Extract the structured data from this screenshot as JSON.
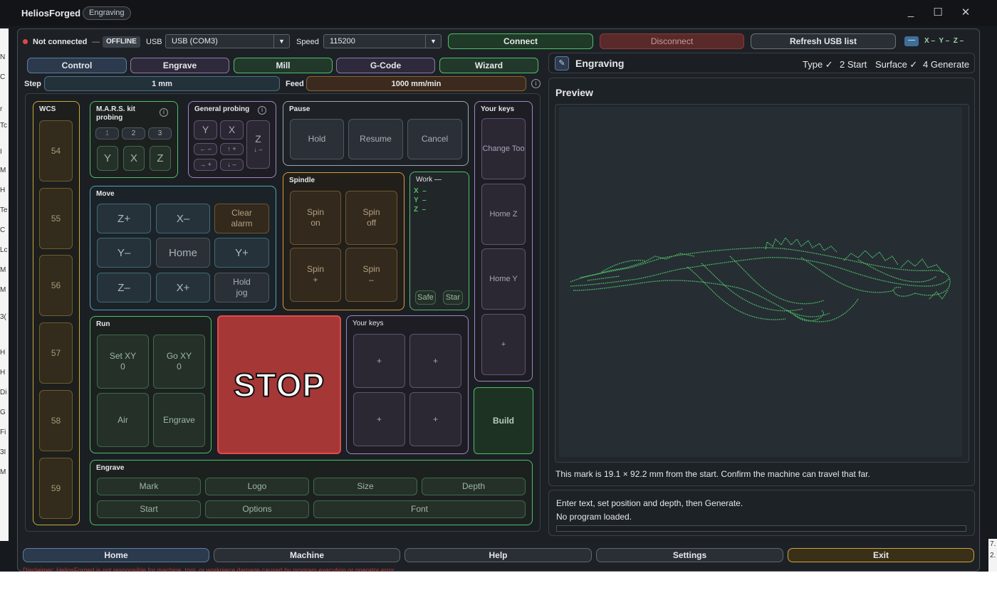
{
  "window": {
    "title": "HeliosForged",
    "badge": "Engraving",
    "controls": {
      "minimize": "_",
      "maximize": "☐",
      "close": "✕"
    }
  },
  "connection": {
    "status": "Not connected",
    "dash": "—",
    "badge": "OFFLINE",
    "usb_label": "USB",
    "usb_value": "USB (COM3)",
    "speed_label": "Speed",
    "speed_value": "115200",
    "connect": "Connect",
    "disconnect": "Disconnect",
    "refresh": "Refresh USB list",
    "coords": "X –  Y –  Z –"
  },
  "mode_tabs": [
    "Control",
    "Engrave",
    "Mill",
    "G-Code",
    "Wizard"
  ],
  "step": {
    "label": "Step",
    "value": "1 mm"
  },
  "feed": {
    "label": "Feed",
    "value": "1000 mm/min",
    "info": "i"
  },
  "wcs": {
    "title": "WCS",
    "items": [
      "54",
      "55",
      "56",
      "57",
      "58",
      "59"
    ]
  },
  "mars": {
    "title": "M.A.R.S. kit probing",
    "info": "i",
    "numbers": [
      "1",
      "2",
      "3"
    ],
    "axes": [
      "Y",
      "X",
      "Z"
    ]
  },
  "general_probing": {
    "title": "General probing",
    "info": "i",
    "keys": [
      "Y",
      "X",
      "Z"
    ],
    "arrows": [
      "← –",
      "↑ +",
      "→ +",
      "↓ –"
    ],
    "z_sub": "↓ –"
  },
  "pause": {
    "title": "Pause",
    "keys": [
      "Hold",
      "Resume",
      "Cancel"
    ]
  },
  "your_keys_right": {
    "title": "Your keys",
    "keys": [
      "Change Too",
      "Home Z",
      "Home Y",
      "+"
    ]
  },
  "move": {
    "title": "Move",
    "keys": [
      "Z+",
      "X–",
      "Clear alarm",
      "Y–",
      "Home",
      "Y+",
      "Z–",
      "X+",
      "Hold jog"
    ]
  },
  "spindle": {
    "title": "Spindle",
    "keys": [
      "Spin on",
      "Spin off",
      "Spin +",
      "Spin –"
    ]
  },
  "work": {
    "title": "Work —",
    "rows": [
      "X  –",
      "Y  –",
      "Z  –"
    ],
    "buttons": [
      "Safe",
      "Star"
    ]
  },
  "run": {
    "title": "Run",
    "keys": [
      "Set XY 0",
      "Go XY 0",
      "Air",
      "Engrave"
    ]
  },
  "stop": "STOP",
  "your_keys_mid": {
    "title": "Your keys",
    "keys": [
      "+",
      "+",
      "+",
      "+"
    ]
  },
  "build": "Build",
  "engrave_panel": {
    "title": "Engrave",
    "row1": [
      "Mark",
      "Logo",
      "Size",
      "Depth"
    ],
    "row2": [
      "Start",
      "Options",
      "Font"
    ]
  },
  "engraving_header": {
    "title": "Engraving",
    "steps": [
      "Type ✓",
      "2 Start",
      "Surface ✓",
      "4 Generate"
    ]
  },
  "preview": {
    "title": "Preview",
    "note": "This mark is 19.1 × 92.2 mm from the start. Confirm the machine can travel that far."
  },
  "status": {
    "line1": "Enter text, set position and depth, then Generate.",
    "line2": "No program loaded."
  },
  "bottom_nav": [
    "Home",
    "Machine",
    "Help",
    "Settings",
    "Exit"
  ],
  "disclaimer": "Disclaimer: HeliosForged is not responsible for machine, tool, or workpiece damage caused by program execution or operator error.",
  "colors": {
    "green": "#4fbf6a",
    "teal": "#4ea4b6",
    "orange": "#d69a3c",
    "purple": "#9d86c6",
    "yellow": "#c9a93c",
    "red_stop": "#b33b3b",
    "exit": "#c9a93c"
  }
}
